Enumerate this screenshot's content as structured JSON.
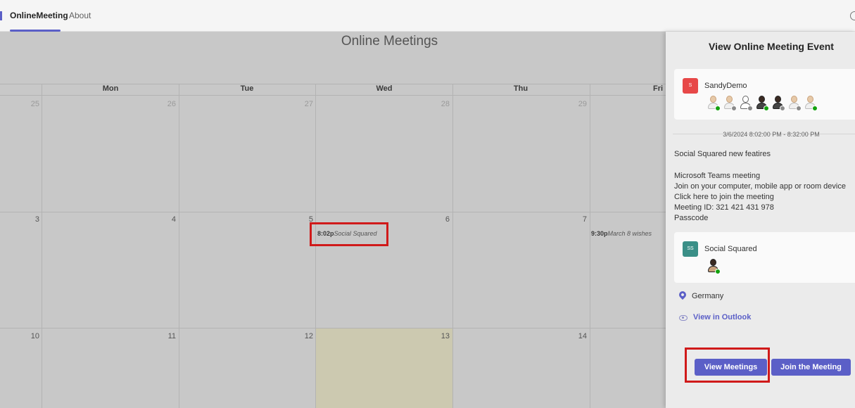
{
  "header": {
    "tabs": [
      {
        "label": "OnlineMeeting",
        "active": true
      },
      {
        "label": "About",
        "active": false
      }
    ]
  },
  "calendar": {
    "title": "Online Meetings",
    "days": [
      "Mon",
      "Tue",
      "Wed",
      "Thu",
      "Fri"
    ],
    "weeks": [
      {
        "numbers": [
          "25",
          "26",
          "27",
          "28",
          "29"
        ]
      },
      {
        "numbers": [
          "3",
          "4",
          "5",
          "6",
          "7"
        ]
      },
      {
        "numbers": [
          "10",
          "11",
          "12",
          "13",
          "14"
        ]
      }
    ],
    "events": [
      {
        "time": "8:02p",
        "title": "Social Squared"
      },
      {
        "time": "9:30p",
        "title": "March 8 wishes"
      }
    ],
    "today_color": "#ccc9b0"
  },
  "panel": {
    "title": "View Online Meeting Event",
    "organizer_card": {
      "badge": "S",
      "name": "SandyDemo",
      "badge_color": "#e74848"
    },
    "datetime": "3/6/2024 8:02:00 PM - 8:32:00 PM",
    "description": [
      "Social Squared new featires",
      "",
      "Microsoft Teams meeting",
      "Join on your computer, mobile app or room device",
      "Click here to join the meeting",
      "Meeting ID: 321 421 431 978",
      "Passcode"
    ],
    "team_card": {
      "badge": "SS",
      "name": "Social Squared",
      "badge_color": "#3a8f87"
    },
    "location": "Germany",
    "outlook_link": "View in Outlook",
    "buttons": {
      "view_meetings": "View Meetings",
      "join_meeting": "Join the Meeting"
    },
    "accent_color": "#5b5fc7"
  }
}
